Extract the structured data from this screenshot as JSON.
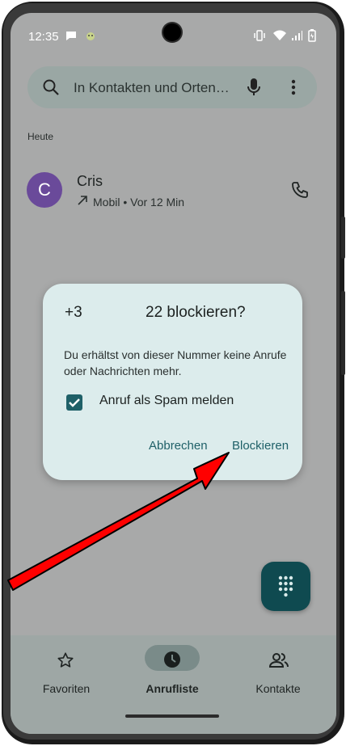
{
  "status_bar": {
    "time": "12:35",
    "icons": [
      "chat-icon",
      "android-icon",
      "vibrate-icon",
      "wifi-icon",
      "signal-icon",
      "battery-icon"
    ]
  },
  "search": {
    "placeholder": "In Kontakten und Orten…",
    "icons": [
      "search-icon",
      "mic-icon",
      "more-vert-icon"
    ]
  },
  "call_log": {
    "section_header": "Heute",
    "entries": [
      {
        "avatar_letter": "C",
        "avatar_color": "#6a4a9a",
        "name": "Cris",
        "subtitle": "Mobil • Vor 12 Min",
        "direction_icon": "outgoing-call-arrow-icon",
        "action_icon": "phone-icon"
      }
    ]
  },
  "dialog": {
    "title_prefix": "+3",
    "title_main": "22 blockieren?",
    "message": "Du erhältst von dieser Nummer keine Anrufe oder Nachrichten mehr.",
    "checkbox_label": "Anruf als Spam melden",
    "checkbox_checked": true,
    "cancel_label": "Abbrechen",
    "confirm_label": "Blockieren"
  },
  "fab": {
    "icon": "dialpad-icon"
  },
  "bottom_nav": {
    "items": [
      {
        "label": "Favoriten",
        "icon": "star-icon",
        "active": false
      },
      {
        "label": "Anrufliste",
        "icon": "clock-icon",
        "active": true
      },
      {
        "label": "Kontakte",
        "icon": "contacts-icon",
        "active": false
      }
    ]
  },
  "colors": {
    "accent": "#1f6068",
    "dialog_bg": "#dcecec",
    "fab_bg": "#0f4a50",
    "annotation_arrow": "#ff0000"
  }
}
